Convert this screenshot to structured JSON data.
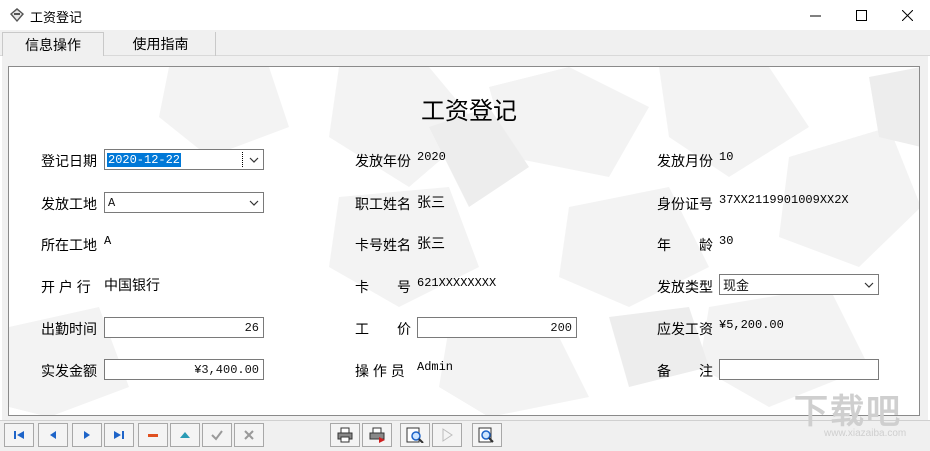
{
  "window": {
    "title": "工资登记",
    "minimize": "—",
    "maximize": "☐",
    "close": "✕"
  },
  "tabs": [
    {
      "label": "信息操作",
      "active": true
    },
    {
      "label": "使用指南",
      "active": false
    }
  ],
  "form": {
    "title": "工资登记",
    "fields": {
      "reg_date": {
        "label": "登记日期",
        "value": "2020-12-22"
      },
      "pay_year": {
        "label": "发放年份",
        "value": "2020"
      },
      "pay_month": {
        "label": "发放月份",
        "value": "10"
      },
      "pay_site": {
        "label": "发放工地",
        "value": "A"
      },
      "staff_name": {
        "label": "职工姓名",
        "value": "张三"
      },
      "id_number": {
        "label": "身份证号",
        "value": "37XX2119901009XX2X"
      },
      "site": {
        "label": "所在工地",
        "value": "A"
      },
      "card_name": {
        "label": "卡号姓名",
        "value": "张三"
      },
      "age": {
        "label": "年　　龄",
        "value": "30"
      },
      "bank": {
        "label": "开 户 行",
        "value": "中国银行"
      },
      "card_no": {
        "label": "卡　　号",
        "value": "621XXXXXXXX"
      },
      "pay_type": {
        "label": "发放类型",
        "value": "现金"
      },
      "attendance": {
        "label": "出勤时间",
        "value": "26"
      },
      "unit_price": {
        "label": "工　　价",
        "value": "200"
      },
      "due_salary": {
        "label": "应发工资",
        "value": "¥5,200.00"
      },
      "actual_amount": {
        "label": "实发金额",
        "value": "¥3,400.00"
      },
      "operator": {
        "label": "操 作 员",
        "value": "Admin"
      },
      "remark": {
        "label": "备　　注",
        "value": ""
      }
    }
  },
  "colors": {
    "nav_blue": "#1e64c8",
    "delete_red": "#e05020",
    "up_teal": "#2a9bb5",
    "disabled_gray": "#9a9a9a",
    "selection": "#0078d7"
  },
  "toolbar": {
    "icons": [
      "first-icon",
      "prev-icon",
      "next-icon",
      "last-icon",
      "delete-icon",
      "edit-icon",
      "confirm-icon",
      "cancel-icon",
      "print-icon",
      "print-export-icon",
      "preview-icon",
      "play-icon",
      "search-icon"
    ]
  },
  "watermark": {
    "text": "下载吧",
    "sub": "www.xiazaiba.com"
  }
}
